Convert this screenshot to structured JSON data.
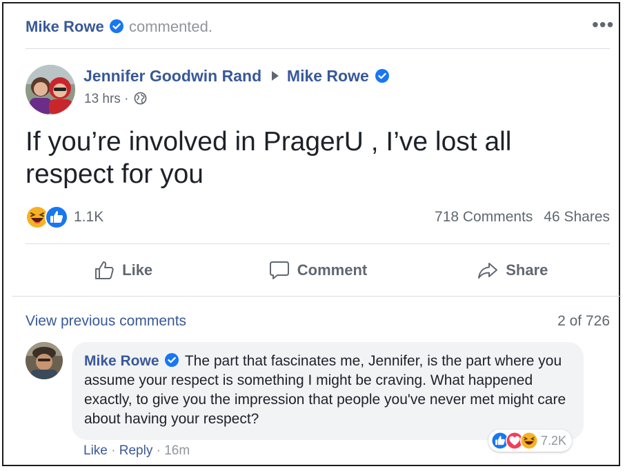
{
  "activity": {
    "actor": "Mike Rowe",
    "verb": "commented."
  },
  "menu": {
    "more_icon": "more-horizontal-icon",
    "more_label": "•••"
  },
  "post": {
    "author": "Jennifer Goodwin Rand",
    "target": "Mike Rowe",
    "time": "13 hrs",
    "separator": "·",
    "privacy_icon": "globe-icon",
    "text": "If you’re involved in PragerU , I’ve lost all respect for you",
    "reactions": {
      "icons": [
        "haha-icon",
        "like-icon"
      ],
      "count": "1.1K"
    },
    "comments_count": "718 Comments",
    "shares_count": "46 Shares"
  },
  "actions": {
    "like": "Like",
    "comment": "Comment",
    "share": "Share"
  },
  "comments_section": {
    "view_previous": "View previous comments",
    "pager": "2 of 726"
  },
  "comment": {
    "author": "Mike Rowe",
    "text": "The part that fascinates me, Jennifer, is the part where you assume your respect is something I might be craving. What happened exactly, to give you the impression that people you've never met might care about having your respect?",
    "reactions": {
      "icons": [
        "like-icon",
        "love-icon",
        "haha-icon"
      ],
      "count": "7.2K"
    },
    "like_label": "Like",
    "reply_label": "Reply",
    "dot": "·",
    "time": "16m"
  },
  "colors": {
    "link": "#385898",
    "facebook_blue": "#1877f2",
    "love": "#f33e58",
    "haha": "#f7b125"
  }
}
